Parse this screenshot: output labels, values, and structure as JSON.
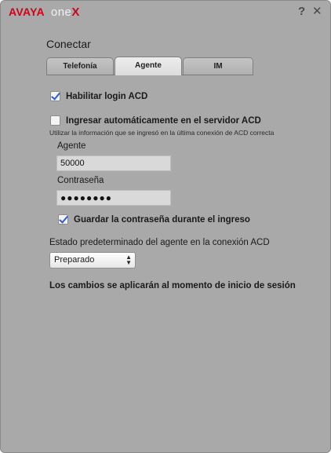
{
  "titlebar": {
    "brand_avaya": "AVAYA",
    "brand_one": "one",
    "brand_x": "X",
    "help_label": "?",
    "close_label": "✕"
  },
  "section_title": "Conectar",
  "tabs": [
    {
      "label": "Telefonía",
      "active": false
    },
    {
      "label": "Agente",
      "active": true
    },
    {
      "label": "IM",
      "active": false
    }
  ],
  "enable_acd": {
    "label": "Habilitar login ACD",
    "checked": true
  },
  "auto_login": {
    "label": "Ingresar automáticamente en el servidor ACD",
    "checked": false
  },
  "hint": "Utilizar la información que se ingresó en la última conexión de ACD correcta",
  "agent": {
    "label": "Agente",
    "value": "50000"
  },
  "password": {
    "label": "Contraseña",
    "value": "●●●●●●●●"
  },
  "save_password": {
    "label": "Guardar la contraseña durante el ingreso",
    "checked": true
  },
  "default_state": {
    "label": "Estado predeterminado del agente en la conexión ACD",
    "selected": "Preparado"
  },
  "note": "Los cambios se aplicarán al momento de inicio de sesión",
  "colors": {
    "brand_red": "#d0021b",
    "window_bg": "#a9a9a9",
    "check_blue": "#2c5bd2"
  }
}
